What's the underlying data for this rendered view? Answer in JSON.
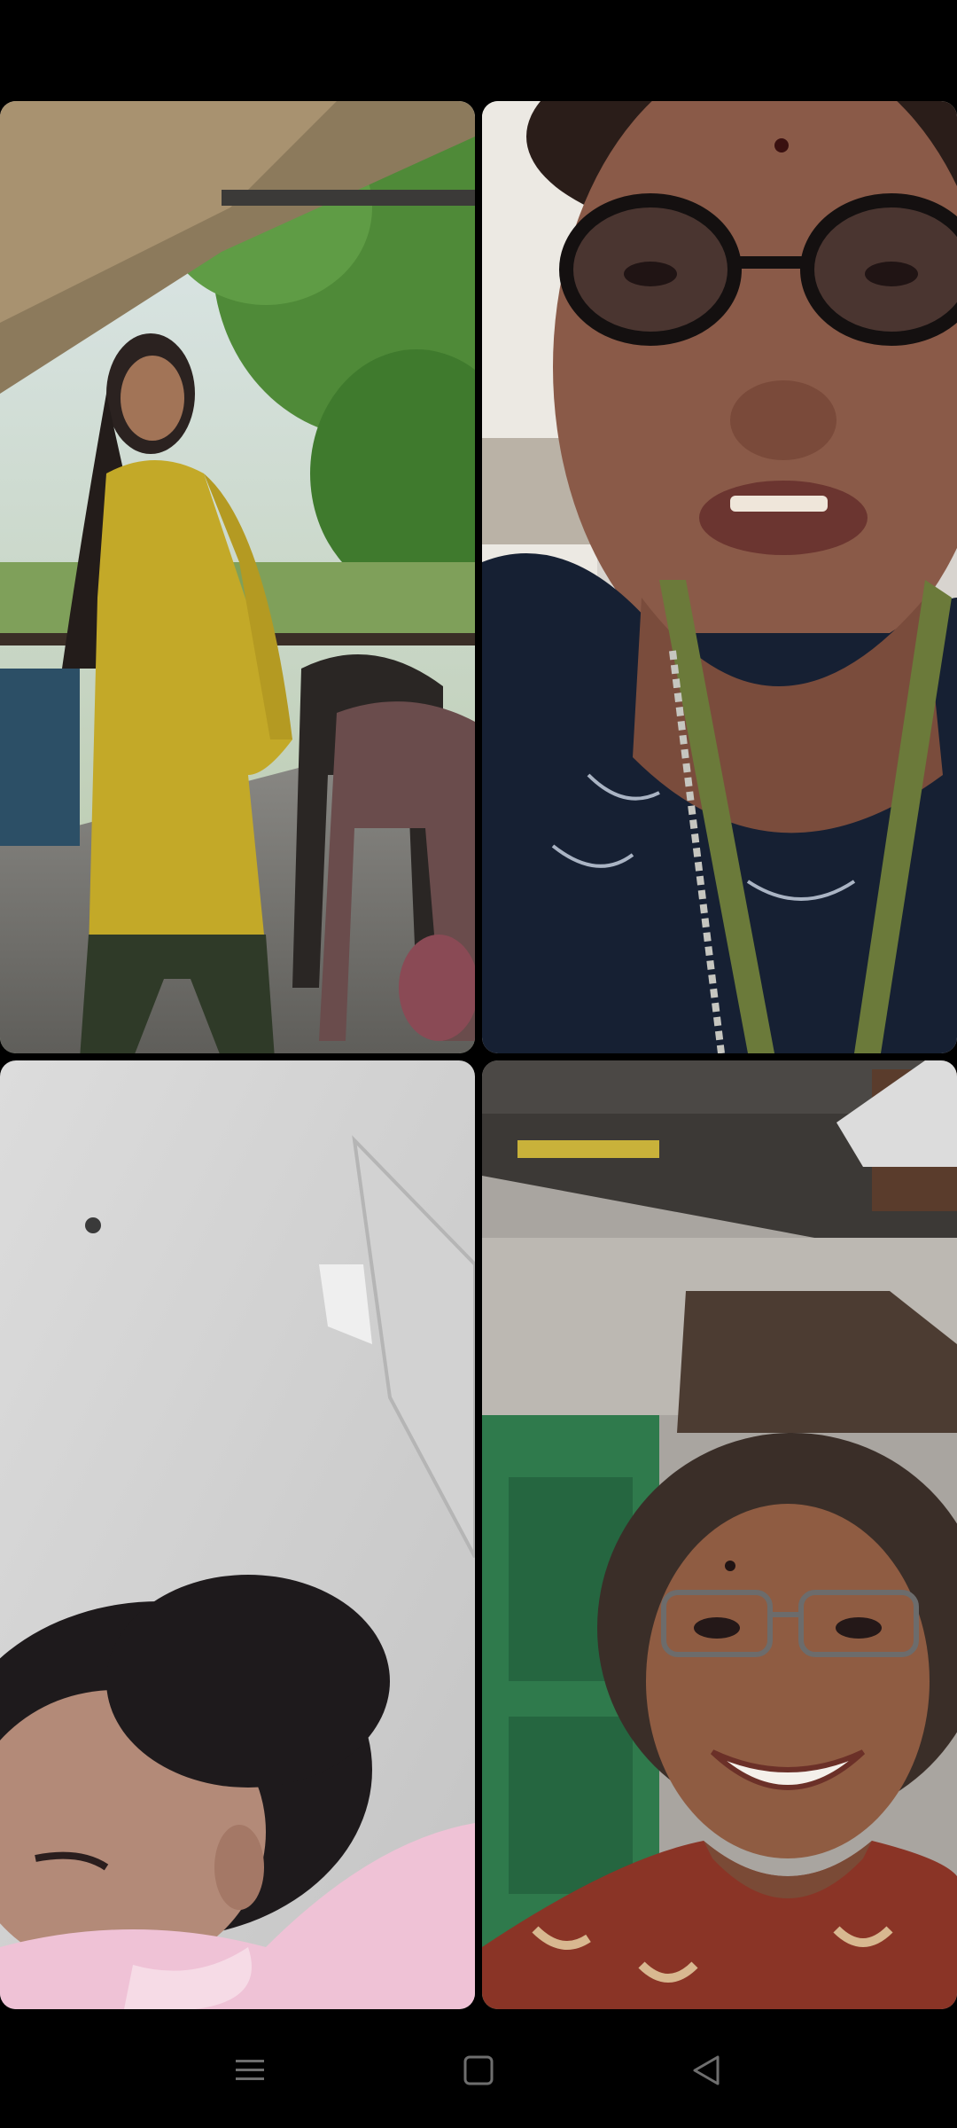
{
  "app": {
    "screen": "video-call-grid"
  },
  "participants": [
    {
      "tile": 1,
      "scene": "outdoor-veranda",
      "accent": "#c9b02a"
    },
    {
      "tile": 2,
      "scene": "close-up-glasses",
      "accent": "#1c2538"
    },
    {
      "tile": 3,
      "scene": "indoor-ceiling",
      "accent": "#f2c9d9"
    },
    {
      "tile": 4,
      "scene": "indoor-green-door",
      "accent": "#2f7a4c"
    }
  ],
  "navigation": {
    "buttons": [
      {
        "icon": "menu-icon"
      },
      {
        "icon": "home-icon"
      },
      {
        "icon": "back-icon"
      }
    ],
    "icon_color": "#6e6e6e"
  }
}
